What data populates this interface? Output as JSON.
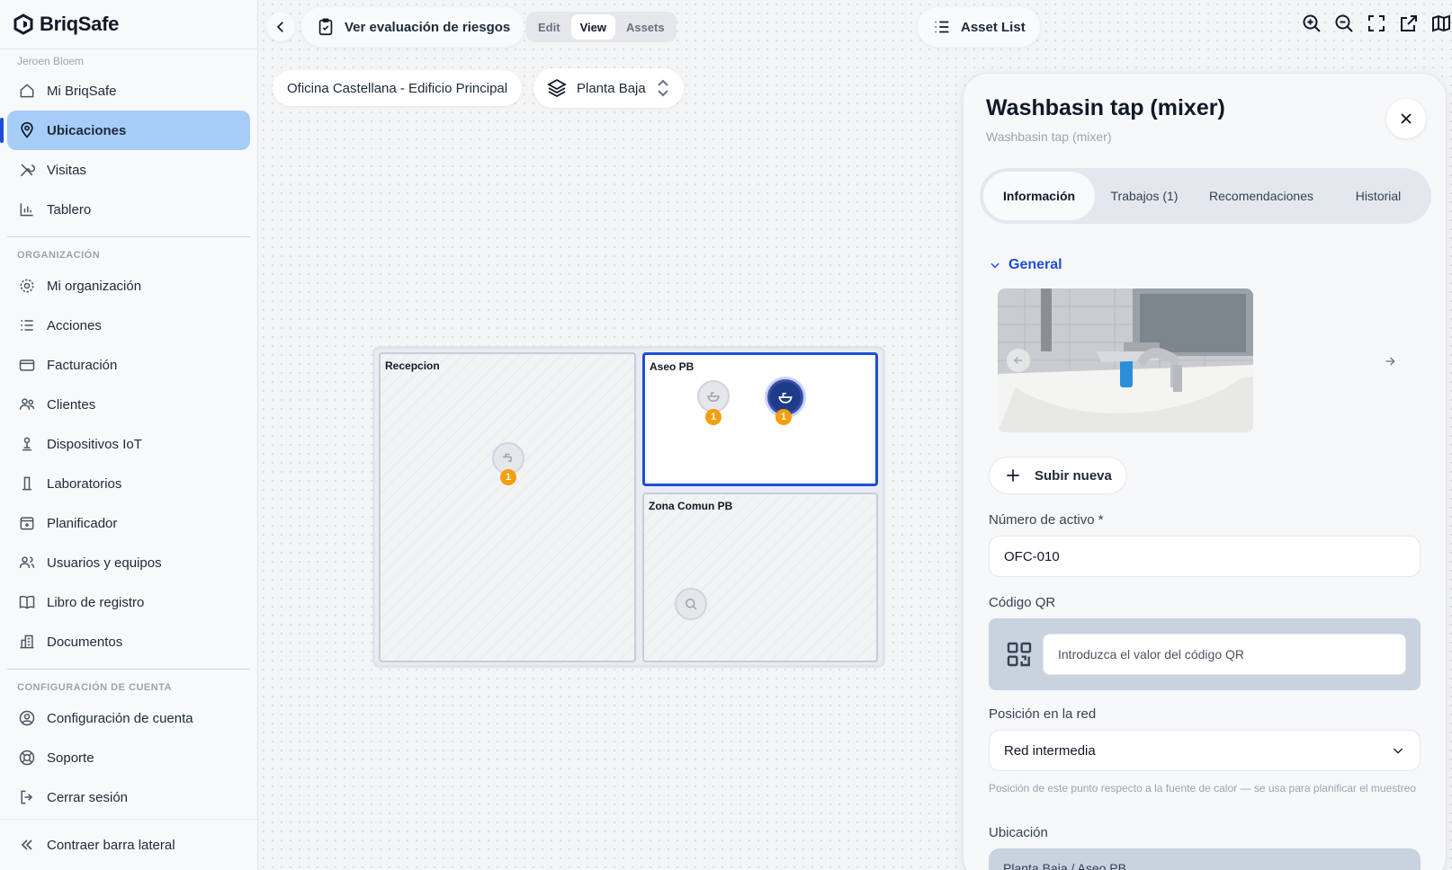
{
  "brand": {
    "name": "BriqSafe"
  },
  "user": {
    "name": "Jeroen Bloem"
  },
  "sidebar": {
    "main_items": [
      {
        "label": "Mi BriqSafe",
        "icon": "home-icon"
      },
      {
        "label": "Ubicaciones",
        "icon": "map-pin-icon",
        "active": true
      },
      {
        "label": "Visitas",
        "icon": "tools-icon"
      },
      {
        "label": "Tablero",
        "icon": "bar-chart-icon"
      }
    ],
    "org_title": "ORGANIZACIÓN",
    "org_items": [
      {
        "label": "Mi organización",
        "icon": "gear-icon"
      },
      {
        "label": "Acciones",
        "icon": "list-icon"
      },
      {
        "label": "Facturación",
        "icon": "credit-card-icon"
      },
      {
        "label": "Clientes",
        "icon": "users-icon"
      },
      {
        "label": "Dispositivos IoT",
        "icon": "sensor-icon"
      },
      {
        "label": "Laboratorios",
        "icon": "flask-icon"
      },
      {
        "label": "Planificador",
        "icon": "calendar-icon"
      },
      {
        "label": "Usuarios y equipos",
        "icon": "team-icon"
      },
      {
        "label": "Libro de registro",
        "icon": "book-icon"
      },
      {
        "label": "Documentos",
        "icon": "building-icon"
      }
    ],
    "account_title": "CONFIGURACIÓN DE CUENTA",
    "account_items": [
      {
        "label": "Configuración de cuenta",
        "icon": "user-circle-icon"
      },
      {
        "label": "Soporte",
        "icon": "lifebuoy-icon"
      },
      {
        "label": "Cerrar sesión",
        "icon": "logout-icon"
      }
    ],
    "collapse_label": "Contraer barra lateral"
  },
  "toolbar": {
    "eval_label": "Ver evaluación de riesgos",
    "modes": [
      "Edit",
      "View",
      "Assets"
    ],
    "active_mode": "View",
    "asset_list_label": "Asset List"
  },
  "location": {
    "building": "Oficina Castellana - Edificio Principal",
    "floor": "Planta Baja"
  },
  "floorplan": {
    "rooms": [
      {
        "name": "Recepcion"
      },
      {
        "name": "Aseo PB",
        "selected": true
      },
      {
        "name": "Zona Comun PB"
      }
    ],
    "badges": [
      "1",
      "1",
      "1"
    ]
  },
  "panel": {
    "title": "Washbasin tap (mixer)",
    "subtitle": "Washbasin tap (mixer)",
    "tabs": [
      "Información",
      "Trabajos (1)",
      "Recomendaciones",
      "Historial"
    ],
    "active_tab": "Información",
    "section_title": "General",
    "upload_label": "Subir nueva",
    "asset_number_label": "Número de activo *",
    "asset_number_value": "OFC-010",
    "qr_label": "Código QR",
    "qr_placeholder": "Introduzca el valor del código QR",
    "network_label": "Posición en la red",
    "network_value": "Red intermedia",
    "network_help": "Posición de este punto respecto a la fuente de calor — se usa para planificar el muestreo",
    "location_label": "Ubicación",
    "location_value": "Planta Baja / Aseo PB"
  },
  "colors": {
    "accent": "#1d4ed8",
    "active_nav": "#a5cdf7",
    "badge": "#f59e0b",
    "selected_pin": "#1e3a8a"
  }
}
